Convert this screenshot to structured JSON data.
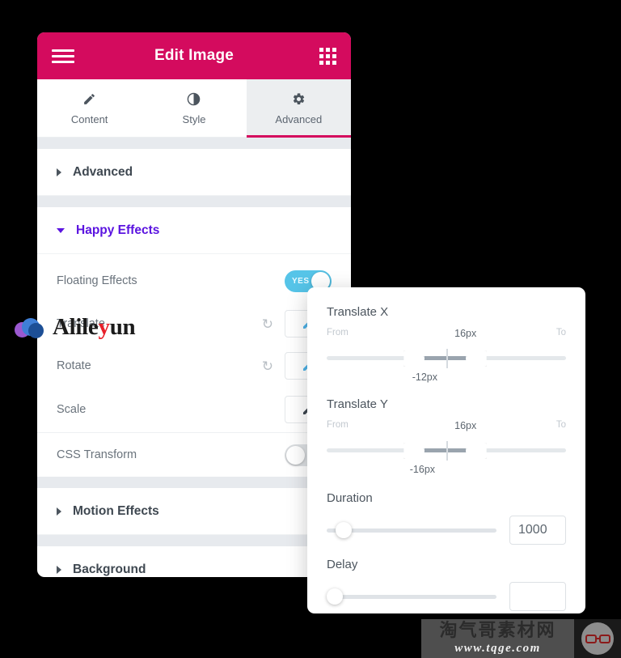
{
  "header": {
    "title": "Edit Image",
    "menu_icon": "hamburger-icon",
    "grid_icon": "grid-apps-icon",
    "color": "#D40B5E"
  },
  "tabs": [
    {
      "label": "Content",
      "icon": "pencil-icon",
      "active": false
    },
    {
      "label": "Style",
      "icon": "contrast-icon",
      "active": false
    },
    {
      "label": "Advanced",
      "icon": "gear-icon",
      "active": true
    }
  ],
  "sections": [
    {
      "label": "Advanced",
      "expanded": false,
      "accent": false
    },
    {
      "label": "Happy Effects",
      "expanded": true,
      "accent": true
    },
    {
      "label": "Motion Effects",
      "expanded": false,
      "accent": false
    },
    {
      "label": "Background",
      "expanded": false,
      "accent": false
    }
  ],
  "accent_color": "#5B14E0",
  "controls": {
    "floating_effects": {
      "label": "Floating Effects",
      "toggle_state": "on",
      "toggle_text": "YES"
    },
    "translate": {
      "label": "Translate",
      "reset_icon": "reset-icon",
      "edit_icon": "pencil-icon",
      "edit_active": true
    },
    "rotate": {
      "label": "Rotate",
      "reset_icon": "reset-icon",
      "edit_icon": "pencil-icon",
      "edit_active": true
    },
    "scale": {
      "label": "Scale",
      "edit_icon": "pencil-icon",
      "edit_active": false
    },
    "css_transform": {
      "label": "CSS Transform",
      "toggle_state": "off"
    }
  },
  "popup": {
    "translate_x": {
      "title": "Translate X",
      "from_label": "From",
      "to_label": "To",
      "low_value": "-12px",
      "high_value": "16px",
      "low_pct": 41,
      "high_pct": 58
    },
    "translate_y": {
      "title": "Translate Y",
      "from_label": "From",
      "to_label": "To",
      "low_value": "-16px",
      "high_value": "16px",
      "low_pct": 41,
      "high_pct": 58
    },
    "duration": {
      "title": "Duration",
      "value": "1000",
      "slider_pct": 5
    },
    "delay": {
      "title": "Delay",
      "value": "",
      "slider_pct": 0
    }
  },
  "watermarks": {
    "alileyun": {
      "text_a": "Alile",
      "text_y": "y",
      "text_b": "un",
      "logo": "cloud-logo"
    },
    "tqge": {
      "cn": "淘气哥素材网",
      "url": "www.tqge.com",
      "logo": "glasses-icon"
    }
  }
}
